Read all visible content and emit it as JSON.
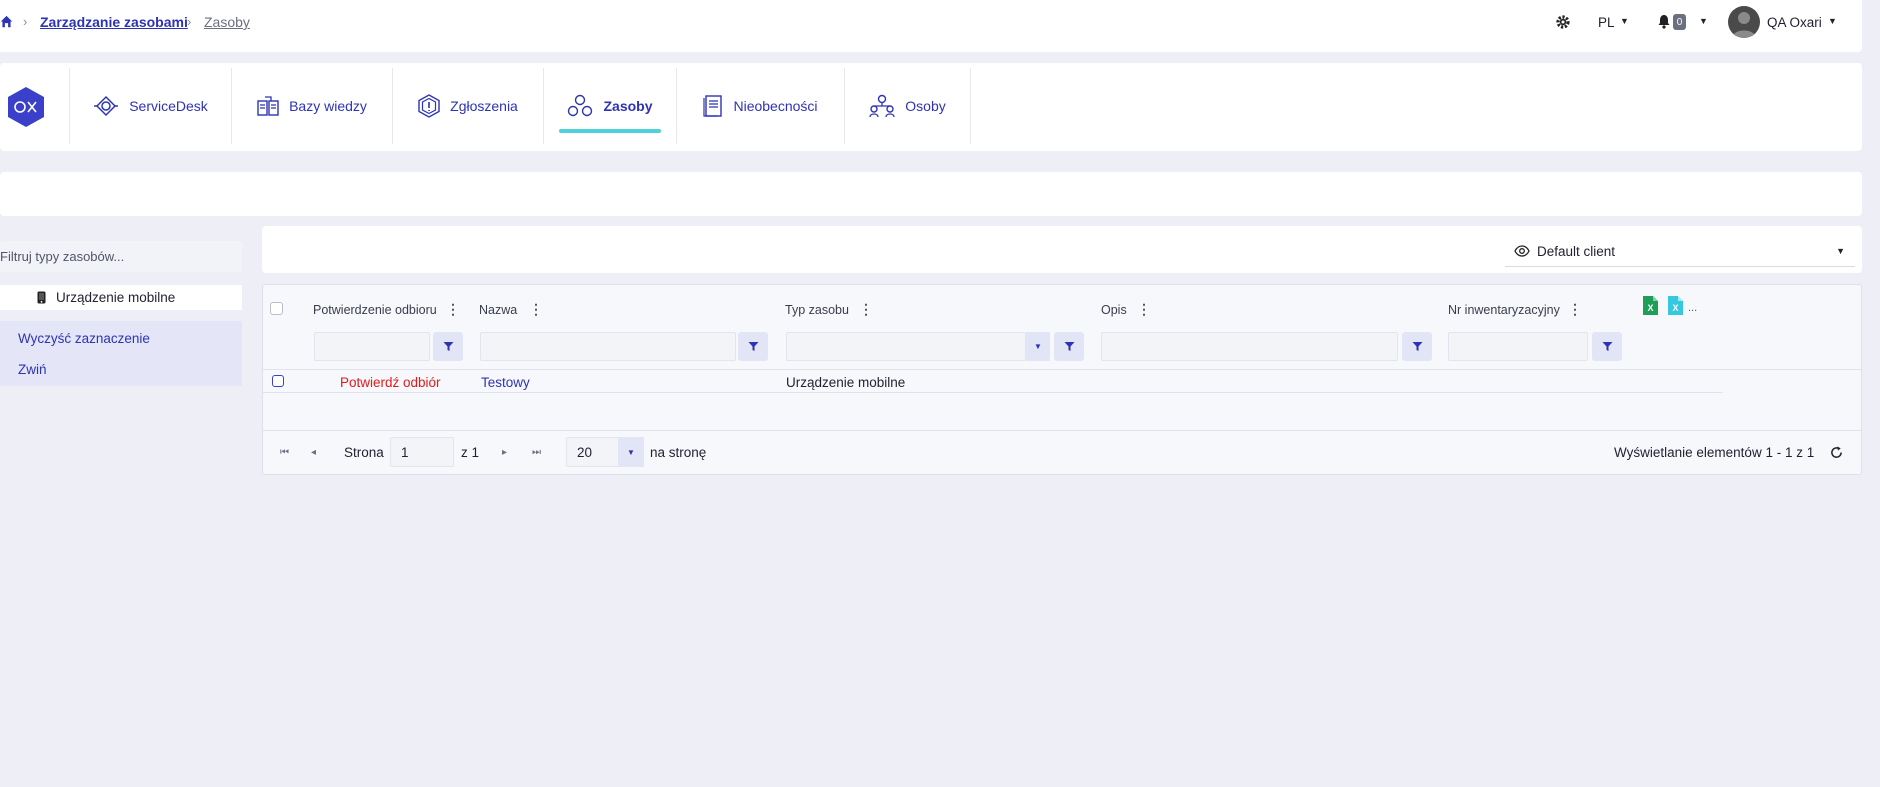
{
  "breadcrumb": {
    "home_icon": "home-icon",
    "parent": "Zarządzanie zasobami",
    "current": "Zasoby"
  },
  "topbar": {
    "language": "PL",
    "notification_count": "0",
    "user_name": "QA Oxari"
  },
  "nav": {
    "items": [
      {
        "label": "ServiceDesk",
        "icon": "servicedesk-icon"
      },
      {
        "label": "Bazy wiedzy",
        "icon": "knowledge-base-icon"
      },
      {
        "label": "Zgłoszenia",
        "icon": "tickets-icon"
      },
      {
        "label": "Zasoby",
        "icon": "assets-icon",
        "active": true
      },
      {
        "label": "Nieobecności",
        "icon": "absences-icon"
      },
      {
        "label": "Osoby",
        "icon": "people-icon"
      }
    ],
    "active_color": "#4fd1d9"
  },
  "sidebar": {
    "filter_placeholder": "Filtruj typy zasobów...",
    "tree_item": "Urządzenie mobilne",
    "clear_selection": "Wyczyść zaznaczenie",
    "collapse": "Zwiń"
  },
  "view": {
    "selected": "Default client"
  },
  "grid": {
    "columns": [
      "Potwierdzenie odbioru",
      "Nazwa",
      "Typ zasobu",
      "Opis",
      "Nr inwentaryzacyjny"
    ],
    "export_more": "...",
    "rows": [
      {
        "confirm": "Potwierdź odbiór",
        "name": "Testowy",
        "type": "Urządzenie mobilne",
        "description": "",
        "inventory_no": ""
      }
    ]
  },
  "pager": {
    "page_label": "Strona",
    "page": "1",
    "of_label": "z 1",
    "page_size": "20",
    "per_page_label": "na stronę",
    "summary": "Wyświetlanie elementów 1 - 1 z 1"
  },
  "colors": {
    "brand": "#2d33b5",
    "danger": "#e01b1b",
    "excel_green": "#1e9e57",
    "excel_cyan": "#35c8df"
  }
}
